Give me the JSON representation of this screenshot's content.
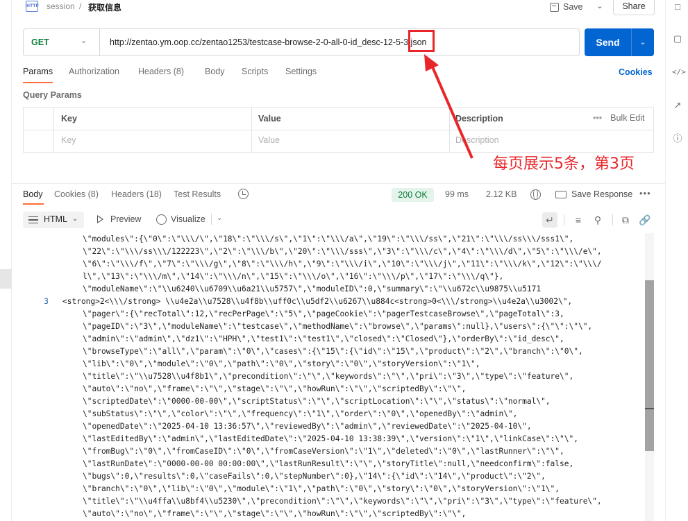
{
  "header": {
    "breadcrumb_parent": "session",
    "breadcrumb_sep": "/",
    "title": "获取信息",
    "http_icon_text": "HTTP",
    "save_label": "Save",
    "share_label": "Share"
  },
  "request": {
    "method": "GET",
    "url": "http://zentao.ym.oop.cc/zentao1253/testcase-browse-2-0-all-0-id_desc-12-5-3.json",
    "send_label": "Send"
  },
  "annotation": {
    "text": "每页展示5条，第3页",
    "color": "#e8262a"
  },
  "request_tabs": [
    {
      "label": "Params",
      "active": true
    },
    {
      "label": "Authorization",
      "active": false
    },
    {
      "label": "Headers (8)",
      "active": false
    },
    {
      "label": "Body",
      "active": false
    },
    {
      "label": "Scripts",
      "active": false
    },
    {
      "label": "Settings",
      "active": false
    }
  ],
  "cookies_label": "Cookies",
  "query_params": {
    "label": "Query Params",
    "columns": [
      "Key",
      "Value",
      "Description"
    ],
    "placeholders": [
      "Key",
      "Value",
      "Description"
    ],
    "bulk_edit": "Bulk Edit"
  },
  "response_tabs": [
    {
      "label": "Body",
      "active": true
    },
    {
      "label": "Cookies (8)",
      "active": false
    },
    {
      "label": "Headers (18)",
      "active": false
    },
    {
      "label": "Test Results",
      "active": false
    }
  ],
  "response_meta": {
    "status": "200 OK",
    "time": "99 ms",
    "size": "2.12 KB",
    "save_response": "Save Response"
  },
  "response_toolbar": {
    "format": "HTML",
    "preview": "Preview",
    "visualize": "Visualize"
  },
  "code_lines": [
    {
      "num": "",
      "text": "\\\"modules\\\":{\\\"0\\\":\\\"\\\\\\/\\\",\\\"18\\\":\\\"\\\\\\/s\\\",\\\"1\\\":\\\"\\\\\\/a\\\",\\\"19\\\":\\\"\\\\\\/ss\\\",\\\"21\\\":\\\"\\\\\\/ss\\\\\\/sss1\\\","
    },
    {
      "num": "",
      "text": "\\\"22\\\":\\\"\\\\\\/ss\\\\\\/122223\\\",\\\"2\\\":\\\"\\\\\\/b\\\",\\\"20\\\":\\\"\\\\\\/sss\\\",\\\"3\\\":\\\"\\\\\\/c\\\",\\\"4\\\":\\\"\\\\\\/d\\\",\\\"5\\\":\\\"\\\\\\/e\\\","
    },
    {
      "num": "",
      "text": "\\\"6\\\":\\\"\\\\\\/f\\\",\\\"7\\\":\\\"\\\\\\/g\\\",\\\"8\\\":\\\"\\\\\\/h\\\",\\\"9\\\":\\\"\\\\\\/i\\\",\\\"10\\\":\\\"\\\\\\/j\\\",\\\"11\\\":\\\"\\\\\\/k\\\",\\\"12\\\":\\\"\\\\\\/"
    },
    {
      "num": "",
      "text": "l\\\",\\\"13\\\":\\\"\\\\\\/m\\\",\\\"14\\\":\\\"\\\\\\/n\\\",\\\"15\\\":\\\"\\\\\\/o\\\",\\\"16\\\":\\\"\\\\\\/p\\\",\\\"17\\\":\\\"\\\\\\/q\\\"},"
    },
    {
      "num": "",
      "text": "\\\"moduleName\\\":\\\"\\\\u6240\\\\u6709\\\\u6a21\\\\u5757\\\",\\\"moduleID\\\":0,\\\"summary\\\":\\\"\\\\u672c\\\\u9875\\\\u5171"
    },
    {
      "num": "3",
      "text": "<strong>2<\\\\\\/strong> \\\\u4e2a\\\\u7528\\\\u4f8b\\\\uff0c\\\\u5df2\\\\u6267\\\\u884c<strong>0<\\\\\\/strong>\\\\u4e2a\\\\u3002\\\","
    },
    {
      "num": "",
      "text": "\\\"pager\\\":{\\\"recTotal\\\":12,\\\"recPerPage\\\":\\\"5\\\",\\\"pageCookie\\\":\\\"pagerTestcaseBrowse\\\",\\\"pageTotal\\\":3,"
    },
    {
      "num": "",
      "text": "\\\"pageID\\\":\\\"3\\\",\\\"moduleName\\\":\\\"testcase\\\",\\\"methodName\\\":\\\"browse\\\",\\\"params\\\":null},\\\"users\\\":{\\\"\\\":\\\"\\\","
    },
    {
      "num": "",
      "text": "\\\"admin\\\":\\\"admin\\\",\\\"dz1\\\":\\\"HPH\\\",\\\"test1\\\":\\\"test1\\\",\\\"closed\\\":\\\"Closed\\\"},\\\"orderBy\\\":\\\"id_desc\\\","
    },
    {
      "num": "",
      "text": "\\\"browseType\\\":\\\"all\\\",\\\"param\\\":\\\"0\\\",\\\"cases\\\":{\\\"15\\\":{\\\"id\\\":\\\"15\\\",\\\"product\\\":\\\"2\\\",\\\"branch\\\":\\\"0\\\","
    },
    {
      "num": "",
      "text": "\\\"lib\\\":\\\"0\\\",\\\"module\\\":\\\"0\\\",\\\"path\\\":\\\"0\\\",\\\"story\\\":\\\"0\\\",\\\"storyVersion\\\":\\\"1\\\","
    },
    {
      "num": "",
      "text": "\\\"title\\\":\\\"\\\\u7528\\\\u4f8b1\\\",\\\"precondition\\\":\\\"\\\",\\\"keywords\\\":\\\"\\\",\\\"pri\\\":\\\"3\\\",\\\"type\\\":\\\"feature\\\","
    },
    {
      "num": "",
      "text": "\\\"auto\\\":\\\"no\\\",\\\"frame\\\":\\\"\\\",\\\"stage\\\":\\\"\\\",\\\"howRun\\\":\\\"\\\",\\\"scriptedBy\\\":\\\"\\\","
    },
    {
      "num": "",
      "text": "\\\"scriptedDate\\\":\\\"0000-00-00\\\",\\\"scriptStatus\\\":\\\"\\\",\\\"scriptLocation\\\":\\\"\\\",\\\"status\\\":\\\"normal\\\","
    },
    {
      "num": "",
      "text": "\\\"subStatus\\\":\\\"\\\",\\\"color\\\":\\\"\\\",\\\"frequency\\\":\\\"1\\\",\\\"order\\\":\\\"0\\\",\\\"openedBy\\\":\\\"admin\\\","
    },
    {
      "num": "",
      "text": "\\\"openedDate\\\":\\\"2025-04-10 13:36:57\\\",\\\"reviewedBy\\\":\\\"admin\\\",\\\"reviewedDate\\\":\\\"2025-04-10\\\","
    },
    {
      "num": "",
      "text": "\\\"lastEditedBy\\\":\\\"admin\\\",\\\"lastEditedDate\\\":\\\"2025-04-10 13:38:39\\\",\\\"version\\\":\\\"1\\\",\\\"linkCase\\\":\\\"\\\","
    },
    {
      "num": "",
      "text": "\\\"fromBug\\\":\\\"0\\\",\\\"fromCaseID\\\":\\\"0\\\",\\\"fromCaseVersion\\\":\\\"1\\\",\\\"deleted\\\":\\\"0\\\",\\\"lastRunner\\\":\\\"\\\","
    },
    {
      "num": "",
      "text": "\\\"lastRunDate\\\":\\\"0000-00-00 00:00:00\\\",\\\"lastRunResult\\\":\\\"\\\",\\\"storyTitle\\\":null,\\\"needconfirm\\\":false,"
    },
    {
      "num": "",
      "text": "\\\"bugs\\\":0,\\\"results\\\":0,\\\"caseFails\\\":0,\\\"stepNumber\\\":0},\\\"14\\\":{\\\"id\\\":\\\"14\\\",\\\"product\\\":\\\"2\\\","
    },
    {
      "num": "",
      "text": "\\\"branch\\\":\\\"0\\\",\\\"lib\\\":\\\"0\\\",\\\"module\\\":\\\"1\\\",\\\"path\\\":\\\"0\\\",\\\"story\\\":\\\"0\\\",\\\"storyVersion\\\":\\\"1\\\","
    },
    {
      "num": "",
      "text": "\\\"title\\\":\\\"\\\\u4ffa\\\\u8bf4\\\\u5230\\\",\\\"precondition\\\":\\\"\\\",\\\"keywords\\\":\\\"\\\",\\\"pri\\\":\\\"3\\\",\\\"type\\\":\\\"feature\\\","
    },
    {
      "num": "",
      "text": "\\\"auto\\\":\\\"no\\\",\\\"frame\\\":\\\"\\\",\\\"stage\\\":\\\"\\\",\\\"howRun\\\":\\\"\\\",\\\"scriptedBy\\\":\\\"\\\","
    }
  ]
}
